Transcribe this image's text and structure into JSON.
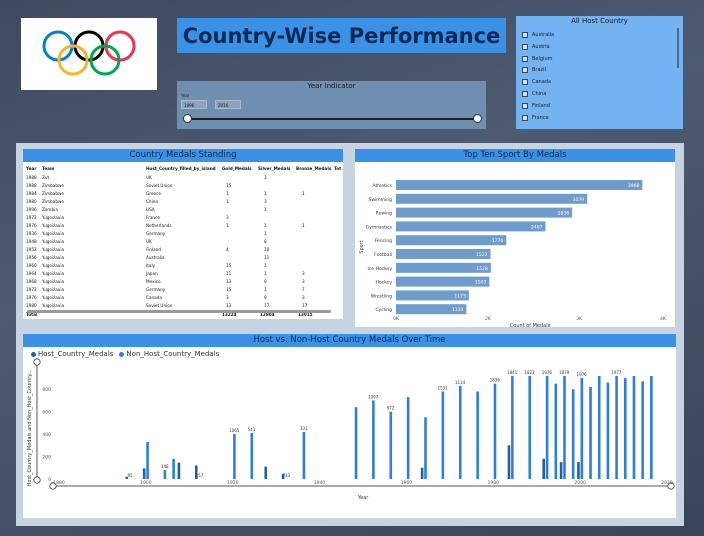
{
  "dashboard": {
    "title": "Country-Wise Performance",
    "year_indicator": {
      "header": "Year Indicator",
      "label": "Year",
      "from": "1896",
      "to": "2016"
    },
    "country_filter": {
      "header": "All Host Country",
      "items": [
        "Australia",
        "Austria",
        "Belgium",
        "Brazil",
        "Canada",
        "China",
        "Finland",
        "France"
      ]
    }
  },
  "medals_table": {
    "title": "Country Medals Standing",
    "columns": [
      "Year",
      "Team",
      "Host_Country_filled_by_island",
      "Gold_Medals",
      "Silver_Medals",
      "Bronze_Medals",
      "Tot"
    ],
    "rows": [
      [
        "1988",
        "Zut",
        "UK",
        "",
        "3",
        ""
      ],
      [
        "1988",
        "Zimbabwe",
        "Soviet Union",
        "15",
        "",
        ""
      ],
      [
        "1984",
        "Zimbabwe",
        "Greece",
        "1",
        "1",
        "1"
      ],
      [
        "1980",
        "Zimbabwe",
        "China",
        "1",
        "3",
        ""
      ],
      [
        "1996",
        "Zambia",
        "USA",
        "",
        "1",
        ""
      ],
      [
        "1972",
        "Yugoslavia",
        "France",
        "3",
        "",
        ""
      ],
      [
        "1976",
        "Yugoslavia",
        "Netherlands",
        "1",
        "1",
        "1"
      ],
      [
        "1936",
        "Yugoslavia",
        "Germany",
        "",
        "1",
        ""
      ],
      [
        "1948",
        "Yugoslavia",
        "UK",
        "",
        "8",
        ""
      ],
      [
        "1952",
        "Yugoslavia",
        "Finland",
        "4",
        "10",
        ""
      ],
      [
        "1956",
        "Yugoslavia",
        "Australia",
        "",
        "11",
        ""
      ],
      [
        "1960",
        "Yugoslavia",
        "Italy",
        "15",
        "1",
        ""
      ],
      [
        "1964",
        "Yugoslavia",
        "Japan",
        "11",
        "1",
        "3"
      ],
      [
        "1968",
        "Yugoslavia",
        "Mexico",
        "13",
        "9",
        "3"
      ],
      [
        "1972",
        "Yugoslavia",
        "Germany",
        "15",
        "1",
        "7"
      ],
      [
        "1976",
        "Yugoslavia",
        "Canada",
        "3",
        "9",
        "3"
      ],
      [
        "1980",
        "Yugoslavia",
        "Soviet Union",
        "13",
        "17",
        "17"
      ]
    ],
    "total": {
      "label": "Total",
      "gold": "13224",
      "silver": "12804",
      "bronze": "13015"
    }
  },
  "chart_data": [
    {
      "type": "bar",
      "orientation": "horizontal",
      "title": "Top Ten Sport By Medals",
      "xlabel": "Count of Medals",
      "ylabel": "Sport",
      "categories": [
        "Athletics",
        "Swimming",
        "Rowing",
        "Gymnastics",
        "Fencing",
        "Football",
        "Ice Hockey",
        "Hockey",
        "Wrestling",
        "Cycling"
      ],
      "values": [
        3968,
        3079,
        2836,
        2407,
        1776,
        1522,
        1528,
        1503,
        1173,
        1133
      ],
      "value_labels": [
        "3968",
        "3079",
        "2836",
        "2407",
        "1776",
        "1522",
        "1528",
        "1503",
        "1173",
        "1133"
      ],
      "xticks": [
        "0K",
        "2K",
        "3K",
        "4K"
      ],
      "xlim": [
        0,
        4300
      ]
    },
    {
      "type": "bar",
      "title": "Host vs. Non-Host Country Medals Over Time",
      "xlabel": "Year",
      "ylabel": "Host_Country_Medals and Non_Host_Country...",
      "legend_position": "top-left",
      "yticks": [
        "0",
        "200",
        "400",
        "600",
        "800"
      ],
      "xticks": [
        "1880",
        "1900",
        "1920",
        "1940",
        "1960",
        "1980",
        "2000",
        "2020"
      ],
      "ylim": [
        0,
        900
      ],
      "xlim": [
        1880,
        2020
      ],
      "series": [
        {
          "name": "Host_Country_Medals",
          "color": "#1e5fa8"
        },
        {
          "name": "Non_Host_Country_Medals",
          "color": "#2f7fd8"
        }
      ],
      "x": [
        1896,
        1900,
        1904,
        1906,
        1908,
        1912,
        1920,
        1924,
        1928,
        1932,
        1936,
        1948,
        1952,
        1956,
        1960,
        1964,
        1968,
        1972,
        1976,
        1980,
        1984,
        1988,
        1992,
        1994,
        1996,
        1998,
        2000,
        2002,
        2004,
        2006,
        2008,
        2010,
        2012,
        2014,
        2016
      ],
      "host": [
        20,
        95,
        0,
        0,
        146,
        120,
        0,
        0,
        110,
        45,
        0,
        0,
        0,
        0,
        0,
        100,
        0,
        0,
        0,
        0,
        300,
        0,
        180,
        0,
        150,
        0,
        151,
        0,
        0,
        0,
        0,
        0,
        0,
        0,
        0
      ],
      "non_host": [
        0,
        330,
        80,
        180,
        0,
        0,
        400,
        410,
        0,
        0,
        420,
        640,
        700,
        600,
        730,
        550,
        780,
        830,
        780,
        850,
        950,
        980,
        1000,
        850,
        950,
        800,
        900,
        820,
        1000,
        860,
        1000,
        900,
        1050,
        870,
        1050
      ],
      "bar_labels": [
        {
          "x": 1896,
          "text": "95"
        },
        {
          "x": 1904,
          "text": "148"
        },
        {
          "x": 1912,
          "text": "157"
        },
        {
          "x": 1920,
          "text": "1065"
        },
        {
          "x": 1924,
          "text": "541"
        },
        {
          "x": 1932,
          "text": "733"
        },
        {
          "x": 1936,
          "text": "331"
        },
        {
          "x": 1952,
          "text": "1097"
        },
        {
          "x": 1956,
          "text": "972"
        },
        {
          "x": 1968,
          "text": "1531"
        },
        {
          "x": 1972,
          "text": "1114"
        },
        {
          "x": 1980,
          "text": "1836"
        },
        {
          "x": 1984,
          "text": "1841"
        },
        {
          "x": 1988,
          "text": "1823"
        },
        {
          "x": 1992,
          "text": "1976"
        },
        {
          "x": 1996,
          "text": "1879"
        },
        {
          "x": 2000,
          "text": "1976"
        },
        {
          "x": 2008,
          "text": "1977"
        }
      ]
    }
  ]
}
